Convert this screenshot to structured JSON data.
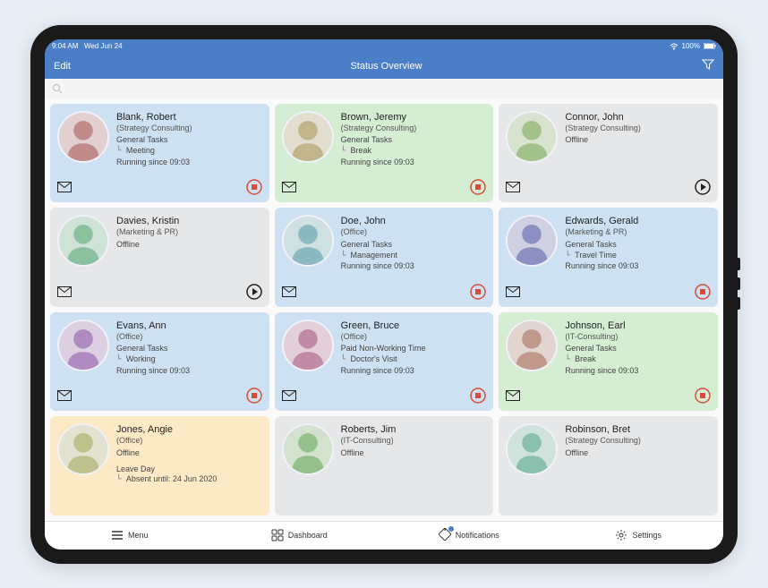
{
  "statusbar": {
    "time": "9:04 AM",
    "date": "Wed Jun 24",
    "battery": "100%"
  },
  "nav": {
    "edit": "Edit",
    "title": "Status Overview"
  },
  "tabs": {
    "menu": "Menu",
    "dashboard": "Dashboard",
    "notifications": "Notifications",
    "settings": "Settings"
  },
  "cards": [
    {
      "name": "Blank, Robert",
      "dept": "(Strategy Consulting)",
      "task": "General Tasks",
      "sub": "Meeting",
      "run": "Running since 09:03",
      "color": "blue",
      "action": "stop"
    },
    {
      "name": "Brown, Jeremy",
      "dept": "(Strategy Consulting)",
      "task": "General Tasks",
      "sub": "Break",
      "run": "Running since 09:03",
      "color": "green",
      "action": "stop"
    },
    {
      "name": "Connor, John",
      "dept": "(Strategy Consulting)",
      "task": "Offline",
      "sub": "",
      "run": "",
      "color": "grey",
      "action": "play"
    },
    {
      "name": "Davies, Kristin",
      "dept": "(Marketing & PR)",
      "task": "Offline",
      "sub": "",
      "run": "",
      "color": "grey",
      "action": "play"
    },
    {
      "name": "Doe, John",
      "dept": "(Office)",
      "task": "General Tasks",
      "sub": "Management",
      "run": "Running since 09:03",
      "color": "blue",
      "action": "stop"
    },
    {
      "name": "Edwards, Gerald",
      "dept": "(Marketing & PR)",
      "task": "General Tasks",
      "sub": "Travel Time",
      "run": "Running since 09:03",
      "color": "blue",
      "action": "stop"
    },
    {
      "name": "Evans, Ann",
      "dept": "(Office)",
      "task": "General Tasks",
      "sub": "Working",
      "run": "Running since 09:03",
      "color": "blue",
      "action": "stop"
    },
    {
      "name": "Green, Bruce",
      "dept": "(Office)",
      "task": "Paid Non-Working Time",
      "sub": "Doctor's Visit",
      "run": "Running since 09:03",
      "color": "blue",
      "action": "stop"
    },
    {
      "name": "Johnson, Earl",
      "dept": "(IT-Consulting)",
      "task": "General Tasks",
      "sub": "Break",
      "run": "Running since 09:03",
      "color": "green",
      "action": "stop"
    },
    {
      "name": "Jones, Angie",
      "dept": "(Office)",
      "task": "Offline",
      "sub": "",
      "run": "",
      "color": "orange",
      "action": "",
      "leave": "Leave Day",
      "leaveSub": "Absent until: 24 Jun 2020"
    },
    {
      "name": "Roberts, Jim",
      "dept": "(IT-Consulting)",
      "task": "Offline",
      "sub": "",
      "run": "",
      "color": "grey",
      "action": ""
    },
    {
      "name": "Robinson, Bret",
      "dept": "(Strategy Consulting)",
      "task": "Offline",
      "sub": "",
      "run": "",
      "color": "grey",
      "action": ""
    }
  ]
}
